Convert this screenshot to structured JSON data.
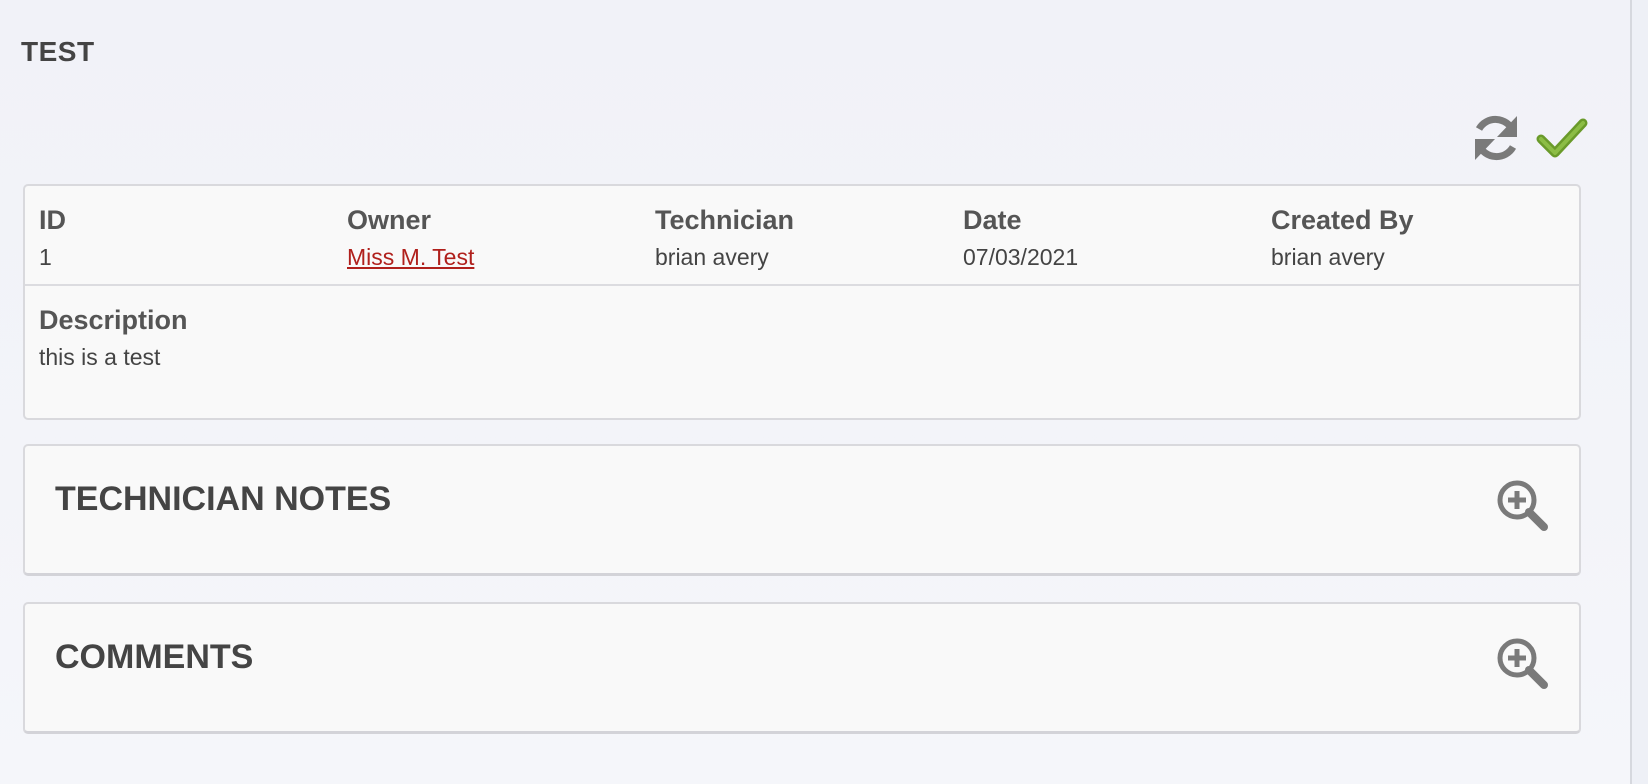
{
  "page": {
    "title": "TEST"
  },
  "toolbar": {
    "refresh_icon": "refresh-icon",
    "confirm_icon": "checkmark-icon"
  },
  "record": {
    "fields": [
      {
        "label": "ID",
        "value": "1"
      },
      {
        "label": "Owner",
        "value": "Miss M. Test"
      },
      {
        "label": "Technician",
        "value": "brian avery"
      },
      {
        "label": "Date",
        "value": "07/03/2021"
      },
      {
        "label": "Created By",
        "value": "brian avery"
      }
    ],
    "description_label": "Description",
    "description_value": "this is a test"
  },
  "sections": {
    "technician_notes": {
      "title": "TECHNICIAN NOTES",
      "icon": "zoom-in-icon"
    },
    "comments": {
      "title": "COMMENTS",
      "icon": "zoom-in-icon"
    }
  },
  "colors": {
    "link": "#b0201c",
    "confirm": "#6a9a2a",
    "icon_gray": "#7a7a7a"
  }
}
